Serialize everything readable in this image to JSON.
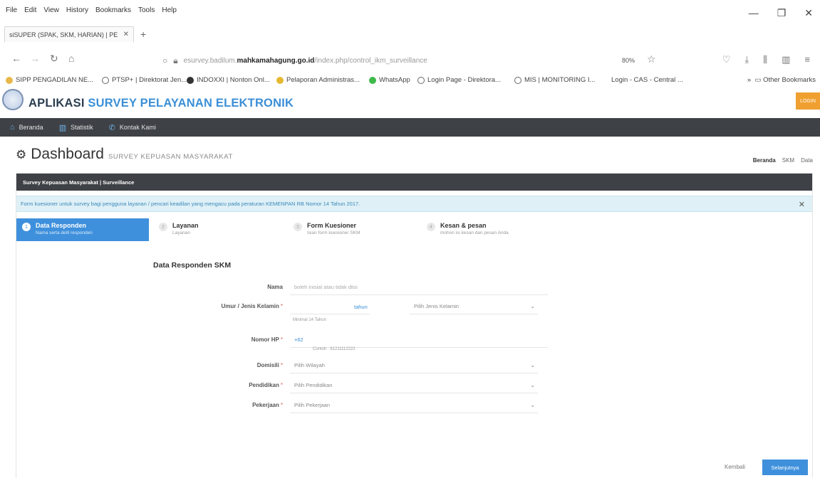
{
  "browser": {
    "menu": [
      "File",
      "Edit",
      "View",
      "History",
      "Bookmarks",
      "Tools",
      "Help"
    ],
    "tab_title": "siSUPER (SPAK, SKM, HARIAN) | PE",
    "url_prefix": "esurvey.badilum.",
    "url_domain": "mahkamahagung.go.id",
    "url_path": "/index.php/control_ikm_surveillance",
    "zoom": "80%",
    "bookmarks": [
      "SIPP PENGADILAN NE...",
      "PTSP+ | Direktorat Jen...",
      "INDOXXI | Nonton Onl...",
      "Pelaporan Administras...",
      "WhatsApp",
      "Login Page - Direktora...",
      "MIS | MONITORING I...",
      "Login - CAS - Central ..."
    ],
    "other_bookmarks": "Other Bookmarks"
  },
  "app": {
    "title_main": "APLIKASI ",
    "title_accent": "SURVEY PELAYANAN ELEKTRONIK",
    "login_label": "LOGIN",
    "nav": [
      "Beranda",
      "Statistik",
      "Kontak Kami"
    ]
  },
  "dashboard": {
    "title": "Dashboard",
    "subtitle": "SURVEY KEPUASAN MASYARAKAT",
    "breadcrumb": [
      "Beranda",
      "SKM",
      "Data"
    ]
  },
  "panel": {
    "header": "Survey Kepuasan Masyarakat | Surveillance",
    "notice": "Form kuesioner untuk survey bagi pengguna layanan / pencari keadilan yang mengacu pada peraturan KEMENPAN RB Nomor 14 Tahun 2017.",
    "steps": [
      {
        "num": "1",
        "title": "Data Responden",
        "sub": "Nama serta detil responden"
      },
      {
        "num": "2",
        "title": "Layanan",
        "sub": "Layanan"
      },
      {
        "num": "3",
        "title": "Form Kuesioner",
        "sub": "Isian form kuesioner SKM"
      },
      {
        "num": "4",
        "title": "Kesan & pesan",
        "sub": "mohon isi kesan dan pesan Anda"
      }
    ]
  },
  "form": {
    "title": "Data Responden SKM",
    "nama_label": "Nama",
    "nama_placeholder": "boleh inisial atau tidak diisi",
    "umur_label": "Umur / Jenis Kelamin",
    "umur_unit": "tahun",
    "umur_hint": "Minimal 14 Tahun",
    "jk_placeholder": "Pilih Jenis Kelamin",
    "hp_label": "Nomor HP",
    "hp_prefix": "+62",
    "hp_hint": "Contoh : 81211112222",
    "domisili_label": "Domisili",
    "domisili_placeholder": "Pilih Wilayah",
    "pendidikan_label": "Pendidikan",
    "pendidikan_placeholder": "Pilih Pendidikan",
    "pekerjaan_label": "Pekerjaan",
    "pekerjaan_placeholder": "Pilih Pekerjaan",
    "required_mark": "*",
    "back_label": "Kembali",
    "next_label": "Selanjutnya"
  }
}
